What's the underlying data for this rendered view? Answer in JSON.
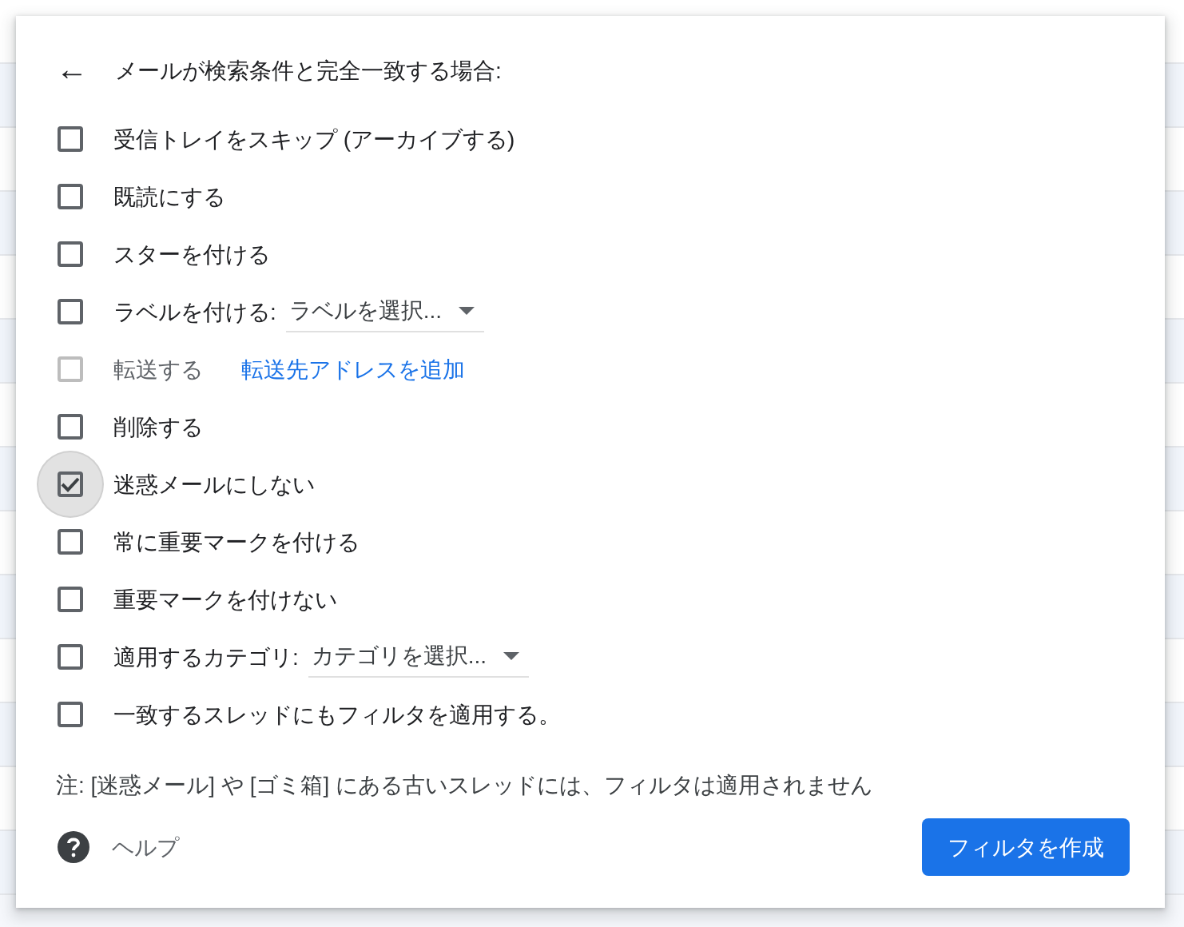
{
  "dialog": {
    "back": "←",
    "title": "メールが検索条件と完全一致する場合:",
    "actions": [
      {
        "kind": "check",
        "label": "受信トレイをスキップ (アーカイブする)",
        "checked": false,
        "disabled": false,
        "focused": false
      },
      {
        "kind": "check",
        "label": "既読にする",
        "checked": false,
        "disabled": false,
        "focused": false
      },
      {
        "kind": "check",
        "label": "スターを付ける",
        "checked": false,
        "disabled": false,
        "focused": false
      },
      {
        "kind": "select",
        "label": "ラベルを付ける:",
        "value": "ラベルを選択...",
        "checked": false,
        "disabled": false,
        "focused": false
      },
      {
        "kind": "link",
        "label": "転送する",
        "link": "転送先アドレスを追加",
        "checked": false,
        "disabled": true,
        "focused": false
      },
      {
        "kind": "check",
        "label": "削除する",
        "checked": false,
        "disabled": false,
        "focused": false
      },
      {
        "kind": "check",
        "label": "迷惑メールにしない",
        "checked": true,
        "disabled": false,
        "focused": true
      },
      {
        "kind": "check",
        "label": "常に重要マークを付ける",
        "checked": false,
        "disabled": false,
        "focused": false
      },
      {
        "kind": "check",
        "label": "重要マークを付けない",
        "checked": false,
        "disabled": false,
        "focused": false
      },
      {
        "kind": "select",
        "label": "適用するカテゴリ:",
        "value": "カテゴリを選択...",
        "checked": false,
        "disabled": false,
        "focused": false
      },
      {
        "kind": "check",
        "label": "一致するスレッドにもフィルタを適用する。",
        "checked": false,
        "disabled": false,
        "focused": false
      }
    ],
    "note": "注: [迷惑メール] や [ゴミ箱] にある古いスレッドには、フィルタは適用されません",
    "help": "ヘルプ",
    "create_button": "フィルタを作成"
  }
}
